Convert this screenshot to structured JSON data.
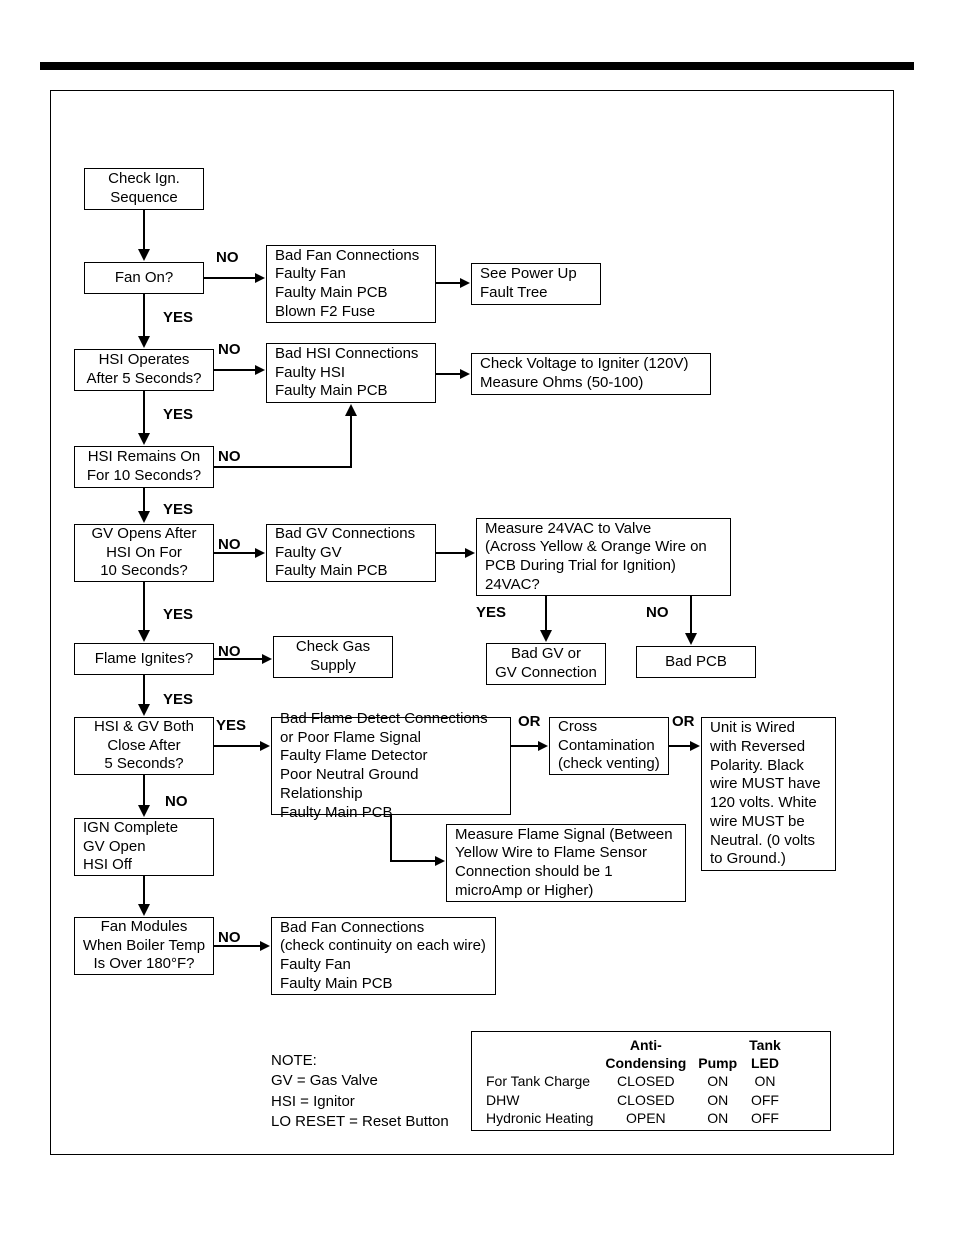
{
  "labels": {
    "yes": "YES",
    "no": "NO",
    "or": "OR"
  },
  "boxes": {
    "check_ign": "Check Ign.\nSequence",
    "fan_on": "Fan On?",
    "bad_fan1": "Bad Fan Connections\nFaulty Fan\nFaulty Main PCB\nBlown F2 Fuse",
    "see_powerup": "See Power Up\nFault Tree",
    "hsi_operates": "HSI Operates\nAfter 5 Seconds?",
    "bad_hsi": "Bad HSI Connections\nFaulty HSI\nFaulty Main PCB",
    "check_voltage": "Check Voltage to Igniter (120V)\nMeasure Ohms (50-100)",
    "hsi_remains": "HSI Remains On\nFor 10 Seconds?",
    "gv_opens": "GV Opens After\nHSI On For\n10 Seconds?",
    "bad_gv": "Bad GV Connections\nFaulty GV\nFaulty Main PCB",
    "measure_24v": "Measure 24VAC to Valve\n(Across Yellow & Orange Wire on\nPCB During Trial for Ignition)\n24VAC?",
    "flame_ignites": "Flame Ignites?",
    "check_gas": "Check Gas\nSupply",
    "bad_gv_or": "Bad GV or\nGV Connection",
    "bad_pcb": "Bad PCB",
    "hsi_gv_close": "HSI & GV Both\nClose After\n5 Seconds?",
    "bad_flame_detect": "Bad Flame Detect Connections\nor Poor Flame Signal\nFaulty Flame Detector\nPoor Neutral Ground Relationship\nFaulty Main PCB",
    "cross_contam": "Cross\nContamination\n(check venting)",
    "unit_wired": "Unit is Wired\nwith Reversed\nPolarity. Black\nwire MUST have\n120 volts. White\nwire MUST be\nNeutral. (0 volts\nto Ground.)",
    "measure_flame": "Measure Flame Signal (Between\nYellow Wire to Flame Sensor\nConnection should be 1\nmicroAmp or Higher)",
    "ign_complete": "IGN Complete\nGV Open\nHSI Off",
    "fan_modules": "Fan Modules\nWhen Boiler Temp\nIs Over 180°F?",
    "bad_fan2": "Bad Fan Connections\n(check continuity on each wire)\nFaulty Fan\nFaulty Main PCB"
  },
  "note": "NOTE:\nGV = Gas Valve\nHSI = Ignitor\nLO RESET = Reset Button",
  "chart_data": {
    "type": "table",
    "title": "",
    "columns": [
      "",
      "Anti-\nCondensing",
      "Pump",
      "Tank\nLED"
    ],
    "rows": [
      [
        "For Tank Charge",
        "CLOSED",
        "ON",
        "ON"
      ],
      [
        "DHW",
        "CLOSED",
        "ON",
        "OFF"
      ],
      [
        "Hydronic Heating",
        "OPEN",
        "ON",
        "OFF"
      ]
    ]
  }
}
